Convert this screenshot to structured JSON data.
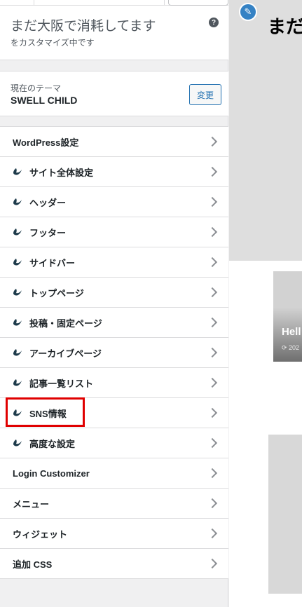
{
  "site": {
    "title": "まだ大阪で消耗してます",
    "subtitle": "をカスタマイズ中です",
    "help_icon": "?"
  },
  "theme": {
    "label": "現在のテーマ",
    "name": "SWELL CHILD",
    "change_button": "変更"
  },
  "menu": {
    "items": [
      {
        "label": "WordPress設定",
        "icon": ""
      },
      {
        "label": "サイト全体設定",
        "icon": "swell-icon"
      },
      {
        "label": "ヘッダー",
        "icon": "swell-icon"
      },
      {
        "label": "フッター",
        "icon": "swell-icon"
      },
      {
        "label": "サイドバー",
        "icon": "swell-icon"
      },
      {
        "label": "トップページ",
        "icon": "swell-icon"
      },
      {
        "label": "投稿・固定ページ",
        "icon": "swell-icon"
      },
      {
        "label": "アーカイブページ",
        "icon": "swell-icon"
      },
      {
        "label": "記事一覧リスト",
        "icon": "swell-icon"
      },
      {
        "label": "SNS情報",
        "icon": "swell-icon",
        "highlighted": true
      },
      {
        "label": "高度な設定",
        "icon": "swell-icon"
      },
      {
        "label": "Login Customizer",
        "icon": ""
      },
      {
        "label": "メニュー",
        "icon": ""
      },
      {
        "label": "ウィジェット",
        "icon": ""
      },
      {
        "label": "追加 CSS",
        "icon": ""
      }
    ]
  },
  "preview": {
    "heading": "まだ",
    "post_title": "Hell",
    "post_date": "⟳ 202",
    "edit_icon": "pencil-icon"
  },
  "colors": {
    "accent": "#2271b1",
    "highlight": "#e00000",
    "swell_icon": "#1d3a4a"
  }
}
